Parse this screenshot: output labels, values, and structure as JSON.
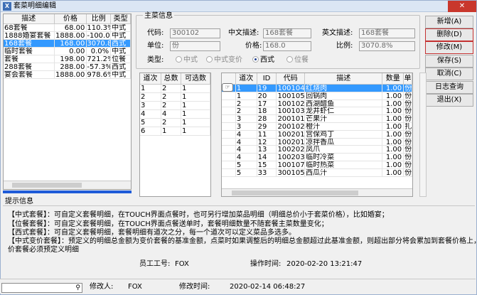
{
  "window": {
    "title": "套菜明细编辑",
    "close_label": "✕"
  },
  "pkg_list": {
    "columns": [
      "描述",
      "价格",
      "比例",
      "类型"
    ],
    "rows": [
      {
        "desc": "68套餐",
        "price": "68.00",
        "ratio": "110.3%",
        "type": "中式"
      },
      {
        "desc": "1888婚宴套餐",
        "price": "1888.00",
        "ratio": "-100.0%",
        "type": "中式"
      },
      {
        "desc": "168套餐",
        "price": "168.00",
        "ratio": "3070.8%",
        "type": "西式",
        "selected": true
      },
      {
        "desc": "临时套餐",
        "price": "0.00",
        "ratio": "0.0%",
        "type": "中式"
      },
      {
        "desc": "套餐",
        "price": "198.00",
        "ratio": "721.2%",
        "type": "位餐"
      },
      {
        "desc": "288套餐",
        "price": "288.00",
        "ratio": "-57.3%",
        "type": "西式"
      },
      {
        "desc": "宴会套餐",
        "price": "1888.00",
        "ratio": "978.6%",
        "type": "中式"
      }
    ]
  },
  "main_info": {
    "title": "主菜信息",
    "code_label": "代码:",
    "code_value": "300102",
    "cn_desc_label": "中文描述:",
    "cn_desc_value": "168套餐",
    "en_desc_label": "英文描述:",
    "en_desc_value": "168套餐",
    "unit_label": "单位:",
    "unit_value": "份",
    "price_label": "价格:",
    "price_value": "168.0",
    "ratio_label": "比例:",
    "ratio_value": "3070.8%",
    "type_label": "类型:",
    "type_options": [
      "中式",
      "中式变价",
      "西式",
      "位餐"
    ],
    "type_selected": "西式"
  },
  "buttons": {
    "add": "新增(A)",
    "delete": "删除(D)",
    "modify": "修改(M)",
    "save": "保存(S)",
    "cancel": "取消(C)",
    "log": "日志查询",
    "exit": "退出(X)"
  },
  "level_grid": {
    "columns": [
      "道次",
      "总数",
      "可选数"
    ],
    "rows": [
      {
        "lvl": "1",
        "total": "2",
        "opt": "1"
      },
      {
        "lvl": "2",
        "total": "2",
        "opt": "1"
      },
      {
        "lvl": "3",
        "total": "2",
        "opt": "1"
      },
      {
        "lvl": "4",
        "total": "4",
        "opt": "1"
      },
      {
        "lvl": "5",
        "total": "2",
        "opt": "1"
      },
      {
        "lvl": "6",
        "total": "1",
        "opt": "1"
      }
    ]
  },
  "detail_grid": {
    "columns": [
      "道次",
      "ID",
      "代码",
      "描述",
      "数量",
      "单"
    ],
    "rows": [
      {
        "lvl": "1",
        "id": "19",
        "code": "100104",
        "desc": "红烧肉",
        "qty": "1.00",
        "unit": "份",
        "selected": true
      },
      {
        "lvl": "1",
        "id": "20",
        "code": "100105",
        "desc": "回锅肉",
        "qty": "1.00",
        "unit": "份"
      },
      {
        "lvl": "2",
        "id": "17",
        "code": "100102",
        "desc": "西湖醋鱼",
        "qty": "1.00",
        "unit": "份"
      },
      {
        "lvl": "2",
        "id": "18",
        "code": "100103",
        "desc": "龙井虾仁",
        "qty": "1.00",
        "unit": "份"
      },
      {
        "lvl": "3",
        "id": "28",
        "code": "200101",
        "desc": "芒果汁",
        "qty": "1.00",
        "unit": "份"
      },
      {
        "lvl": "3",
        "id": "29",
        "code": "200102",
        "desc": "橙汁",
        "qty": "1.00",
        "unit": "扎"
      },
      {
        "lvl": "4",
        "id": "11",
        "code": "100201",
        "desc": "宫保鸡丁",
        "qty": "1.00",
        "unit": "份"
      },
      {
        "lvl": "4",
        "id": "12",
        "code": "100201",
        "desc": "凉拌香瓜",
        "qty": "1.00",
        "unit": "份"
      },
      {
        "lvl": "4",
        "id": "13",
        "code": "100202",
        "desc": "凤爪",
        "qty": "1.00",
        "unit": "份"
      },
      {
        "lvl": "4",
        "id": "14",
        "code": "100203",
        "desc": "临时冷菜",
        "qty": "1.00",
        "unit": "份"
      },
      {
        "lvl": "5",
        "id": "15",
        "code": "100107",
        "desc": "临时热菜",
        "qty": "1.00",
        "unit": "份"
      },
      {
        "lvl": "5",
        "id": "33",
        "code": "300105",
        "desc": "西瓜汁",
        "qty": "1.00",
        "unit": "份"
      }
    ]
  },
  "hint": {
    "title": "提示信息",
    "lines": [
      "【中式套餐】：可自定义套餐明细，在TOUCH界面点餐时，也可另行增加菜品明细（明细总价小于套菜价格），比如婚宴；",
      "【位餐套餐】：可自定义套餐明细，在TOUCH界面点餐送单时，套餐明细数量不随套餐主菜数量变化；",
      "【西式套餐】：可自定义套餐明细，套餐明细有道次之分，每一个道次可以定义菜品多选多。",
      "【中式变价套餐】：预定义的明细总金额为变价套餐的基准金额，点菜时如果调整后的明细总金额超过此基准金额，则超出部分将会累加到套餐价格上，变",
      "价套餐必须预定义明细"
    ]
  },
  "status": {
    "staff_label": "员工工号:",
    "staff_value": "FOX",
    "optime_label": "操作时间:",
    "optime_value": "2020-02-20 13:21:47",
    "modifier_label": "修改人:",
    "modifier_value": "FOX",
    "modtime_label": "修改时间:",
    "modtime_value": "2020-02-14 06:48:27"
  },
  "colors": {
    "selection": "#3399ff",
    "accent_border": "#c43131",
    "title_bar": "#dbe6f4"
  }
}
